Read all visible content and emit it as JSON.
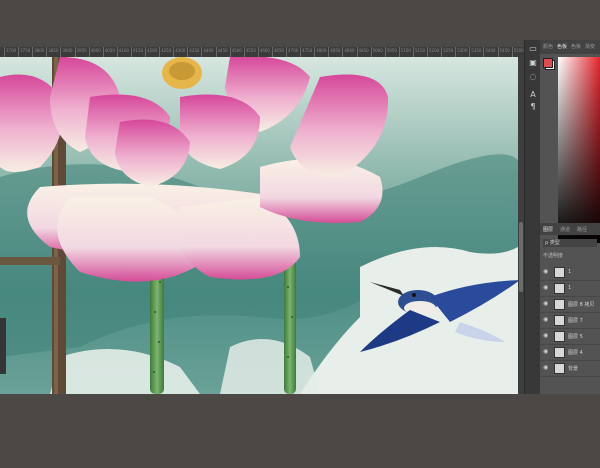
{
  "ruler": {
    "labels": [
      "3700",
      "3750",
      "3800",
      "3850",
      "3900",
      "3950",
      "4000",
      "4050",
      "4100",
      "4150",
      "4200",
      "4250",
      "4300",
      "4350",
      "4400",
      "4450",
      "4500",
      "4550",
      "4600",
      "4650",
      "4700",
      "4750",
      "4800",
      "4850",
      "4900",
      "4950",
      "5000",
      "5050",
      "5100",
      "5150",
      "5200",
      "5250",
      "5300",
      "5350",
      "5400",
      "5450",
      "5500"
    ]
  },
  "right_panel": {
    "tabs": [
      "颜色",
      "色板",
      "色板",
      "渐变"
    ],
    "layers_tabs": [
      "图层",
      "通道",
      "路径"
    ],
    "search_label": "ρ 类型",
    "opacity_label": "不透明度",
    "layers": [
      {
        "name": "1",
        "icon": "eye-icon"
      },
      {
        "name": "1",
        "icon": "eye-icon"
      },
      {
        "name": "图层 8 拷贝",
        "icon": "eye-icon"
      },
      {
        "name": "图层 7",
        "icon": "eye-icon"
      },
      {
        "name": "图层 5",
        "icon": "eye-icon"
      },
      {
        "name": "图层 4",
        "icon": "eye-icon"
      },
      {
        "name": "背景",
        "icon": "eye-icon"
      }
    ],
    "colors": {
      "foreground": "#e04a52",
      "background": "#ffffff",
      "picker_hue": "#e4262f"
    }
  },
  "tools": [
    "move-icon",
    "marquee-icon",
    "lasso-icon",
    "text-icon",
    "settings-icon"
  ]
}
